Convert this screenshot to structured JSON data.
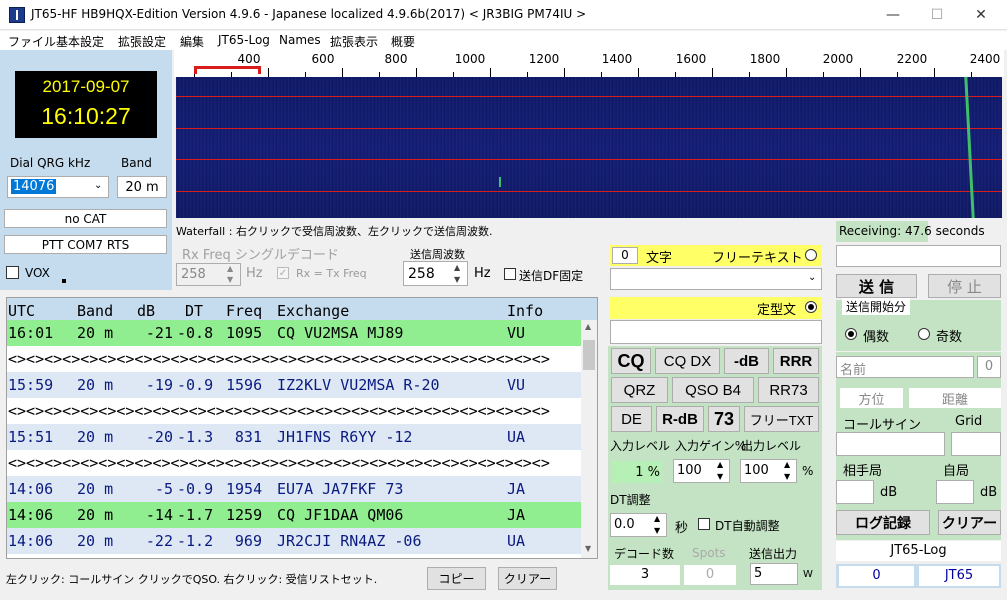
{
  "window": {
    "title": "JT65-HF HB9HQX-Edition Version 4.9.6 - Japanese localized 4.9.6b(2017)   < JR3BIG PM74IU >",
    "controls": {
      "minimize": "—",
      "maximize": "☐",
      "close": "✕"
    }
  },
  "menu": [
    "ファイル",
    "基本設定",
    "拡張設定",
    "編集",
    "JT65-Log",
    "Names",
    "拡張表示",
    "概要"
  ],
  "clock": {
    "date": "2017-09-07",
    "time": "16:10:27"
  },
  "dial": {
    "label": "Dial QRG kHz",
    "value": "14076",
    "band_label": "Band",
    "band": "20 m"
  },
  "cat_status": "no CAT",
  "ptt_status": "PTT COM7 RTS",
  "vox_label": "VOX",
  "scale_labels": [
    "400",
    "600",
    "800",
    "1000",
    "1200",
    "1400",
    "1600",
    "1800",
    "2000",
    "2200",
    "2400"
  ],
  "waterfall_hint": "Waterfall : 右クリックで受信周波数、左クリックで送信周波数.",
  "rx": {
    "label": "Rx Freq シングルデコード",
    "value": "258",
    "unit": "Hz",
    "check_label": "Rx = Tx Freq"
  },
  "tx": {
    "label": "送信周波数",
    "value": "258",
    "unit": "Hz",
    "fix_label": "送信DF固定"
  },
  "decode_header": {
    "utc": "UTC",
    "band": "Band",
    "db": "dB",
    "dt": "DT",
    "freq": "Freq",
    "exchange": "Exchange",
    "info": "Info"
  },
  "decodes": [
    {
      "utc": "16:01",
      "band": "20 m",
      "db": "-21",
      "dt": "-0.8",
      "freq": "1095",
      "exchange": "CQ VU2MSA MJ89",
      "info": "VU",
      "style": "cq"
    },
    {
      "separator": "<><><><><><><><><><><><><><><><><><><><><><><><><><><><><><>"
    },
    {
      "utc": "15:59",
      "band": "20 m",
      "db": "-19",
      "dt": "-0.9",
      "freq": "1596",
      "exchange": "IZ2KLV VU2MSA R-20",
      "info": "VU",
      "style": "blue"
    },
    {
      "separator": "<><><><><><><><><><><><><><><><><><><><><><><><><><><><><><>"
    },
    {
      "utc": "15:51",
      "band": "20 m",
      "db": "-20",
      "dt": "-1.3",
      "freq": "831",
      "exchange": "JH1FNS R6YY -12",
      "info": "UA",
      "style": "blue"
    },
    {
      "separator": "<><><><><><><><><><><><><><><><><><><><><><><><><><><><><><>"
    },
    {
      "utc": "14:06",
      "band": "20 m",
      "db": "-5",
      "dt": "-0.9",
      "freq": "1954",
      "exchange": "EU7A JA7FKF 73",
      "info": "JA",
      "style": "blue"
    },
    {
      "utc": "14:06",
      "band": "20 m",
      "db": "-14",
      "dt": "-1.7",
      "freq": "1259",
      "exchange": "CQ JF1DAA QM06",
      "info": "JA",
      "style": "cq"
    },
    {
      "utc": "14:06",
      "band": "20 m",
      "db": "-22",
      "dt": "-1.2",
      "freq": "969",
      "exchange": "JR2CJI RN4AZ -06",
      "info": "UA",
      "style": "blue"
    }
  ],
  "status_hint": "左クリック: コールサイン クリックでQSO. 右クリック: 受信リストセット.",
  "copy_button": "コピー",
  "clear_button": "クリアー",
  "msg": {
    "count": "0",
    "count_label": "文字",
    "free_text_label": "フリーテキスト",
    "fixed_label": "定型文"
  },
  "macros": {
    "row1": [
      "CQ",
      "CQ DX",
      "-dB",
      "RRR"
    ],
    "row2": [
      "QRZ",
      "QSO B4",
      "RR73"
    ],
    "row3": [
      "DE",
      "R-dB",
      "73",
      "フリーTXT"
    ]
  },
  "levels": {
    "input_label": "入力レベル",
    "gain_label": "入力ゲイン%",
    "output_label": "出力レベル",
    "input_value": "1 %",
    "gain_value": "100",
    "output_value": "100",
    "percent": "%"
  },
  "dt": {
    "label": "DT調整",
    "value": "0.0",
    "unit": "秒",
    "auto_label": "DT自動調整"
  },
  "decode_count": {
    "label": "デコード数",
    "value": "3"
  },
  "spots": {
    "label": "Spots",
    "value": "0"
  },
  "power": {
    "label": "送信出力",
    "value": "5",
    "unit": "W"
  },
  "receiving": {
    "label": "Receiving:",
    "value": "47.6",
    "unit": "seconds"
  },
  "tx_buttons": {
    "send": "送 信",
    "stop": "停 止"
  },
  "period": {
    "label": "送信開始分",
    "even": "偶数",
    "odd": "奇数"
  },
  "log": {
    "name_placeholder": "名前",
    "name_count": "0",
    "bearing_label": "方位",
    "distance_label": "距離",
    "callsign_label": "コールサイン",
    "grid_label": "Grid",
    "their_label": "相手局",
    "mine_label": "自局",
    "db_unit": "dB",
    "log_button": "ログ記録",
    "clear_button": "クリアー",
    "log_title": "JT65-Log",
    "log_count": "0",
    "log_mode": "JT65"
  }
}
